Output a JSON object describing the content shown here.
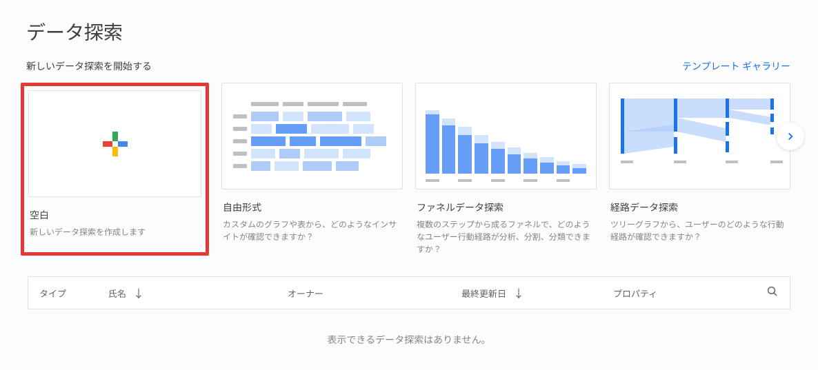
{
  "page": {
    "title": "データ探索",
    "subtitle": "新しいデータ探索を開始する",
    "gallery_link": "テンプレート ギャラリー"
  },
  "cards": {
    "blank": {
      "title": "空白",
      "description": "新しいデータ探索を作成します"
    },
    "freeform": {
      "title": "自由形式",
      "description": "カスタムのグラフや表から、どのようなインサイトが確認できますか？"
    },
    "funnel": {
      "title": "ファネルデータ探索",
      "description": "複数のステップから成るファネルで、どのようなユーザー行動経路が分析、分割、分類できますか？"
    },
    "path": {
      "title": "経路データ探索",
      "description": "ツリーグラフから、ユーザーのどのような行動経路が確認できますか？"
    }
  },
  "table": {
    "headers": {
      "type": "タイプ",
      "name": "氏名",
      "owner": "オーナー",
      "updated": "最終更新日",
      "property": "プロパティ"
    },
    "empty_message": "表示できるデータ探索はありません。"
  }
}
